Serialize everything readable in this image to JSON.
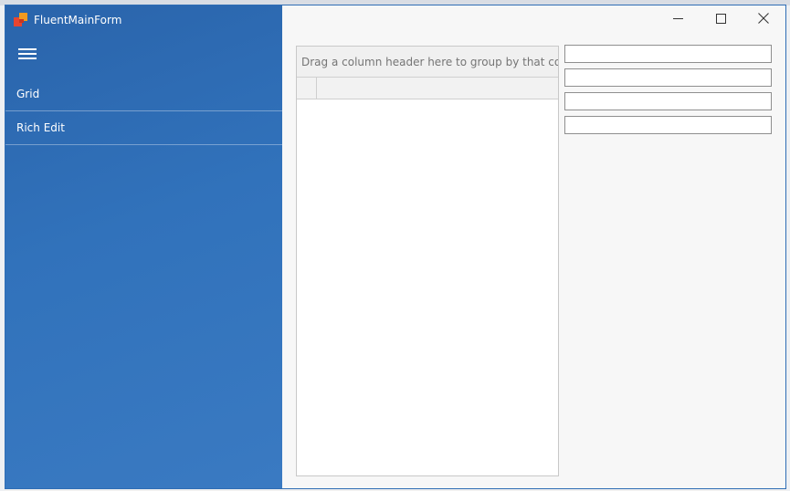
{
  "app": {
    "title": "FluentMainForm",
    "logo_icon": "app-logo-icon",
    "accent": "#2f6db5"
  },
  "window_controls": {
    "minimize_glyph": "—",
    "maximize_glyph": "☐",
    "close_glyph": "✕"
  },
  "nav": {
    "menu_icon": "hamburger-menu-icon",
    "items": [
      {
        "label": "Grid"
      },
      {
        "label": "Rich Edit"
      }
    ]
  },
  "grid": {
    "group_panel_text": "Drag a column header here to group by that column"
  },
  "textboxes": [
    {
      "value": ""
    },
    {
      "value": ""
    },
    {
      "value": ""
    },
    {
      "value": ""
    }
  ]
}
